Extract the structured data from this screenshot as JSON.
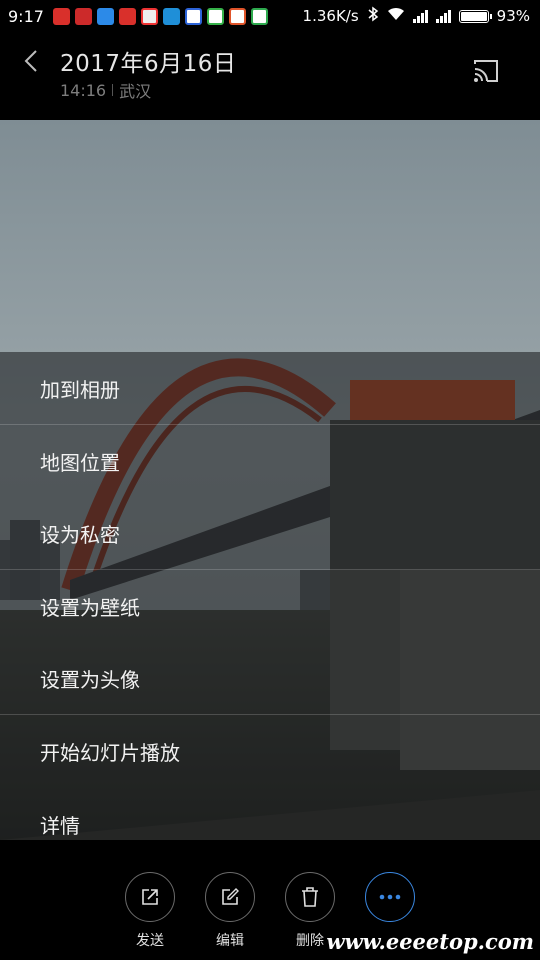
{
  "status_bar": {
    "time": "9:17",
    "network_speed": "1.36K/s",
    "battery": "93%",
    "battery_level": 0.93,
    "app_icons": [
      {
        "name": "weibo-icon",
        "color": "#d9302b"
      },
      {
        "name": "toutiao-icon",
        "color": "#cc2a2a"
      },
      {
        "name": "blue-app-icon",
        "color": "#2c8ae8"
      },
      {
        "name": "weibo-icon-2",
        "color": "#d9302b"
      },
      {
        "name": "news-icon",
        "color": "#e33"
      },
      {
        "name": "weather-icon",
        "color": "#1f8fd8"
      },
      {
        "name": "baidu-icon",
        "color": "#2d64d8"
      },
      {
        "name": "video-icon",
        "color": "#36b24a"
      },
      {
        "name": "news-icon-2",
        "color": "#e0542a"
      },
      {
        "name": "browser-icon",
        "color": "#2eaa4e"
      }
    ]
  },
  "header": {
    "title": "2017年6月16日",
    "time": "14:16",
    "location": "武汉"
  },
  "menu": {
    "items": [
      {
        "label": "加到相册"
      },
      {
        "label": "地图位置"
      },
      {
        "label": "设为私密"
      },
      {
        "label": "设置为壁纸"
      },
      {
        "label": "设置为头像"
      },
      {
        "label": "开始幻灯片播放"
      },
      {
        "label": "详情"
      }
    ]
  },
  "actions": {
    "send": "发送",
    "edit": "编辑",
    "delete": "删除"
  },
  "watermark": "www.eeeetop.com",
  "colors": {
    "accent": "#3a87e0",
    "background": "#000000"
  }
}
